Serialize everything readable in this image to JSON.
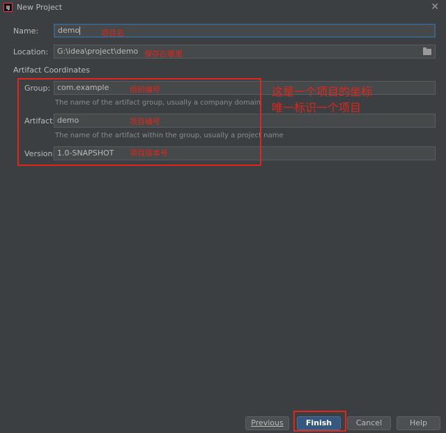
{
  "window": {
    "title": "New Project",
    "app_icon_text": "IJ"
  },
  "form": {
    "name_label": "Name:",
    "name_value": "demo",
    "location_label": "Location:",
    "location_value": "G:\\idea\\project\\demo",
    "section_title": "Artifact Coordinates",
    "group_label": "Group:",
    "group_value": "com.example",
    "group_hint": "The name of the artifact group, usually a company domain",
    "artifact_label": "Artifact:",
    "artifact_value": "demo",
    "artifact_hint": "The name of the artifact within the group, usually a project name",
    "version_label": "Version:",
    "version_value": "1.0-SNAPSHOT"
  },
  "annotations": {
    "name_note": "项目名",
    "location_note": "保存在哪里",
    "group_note": "组织编号",
    "artifact_note": "项目编号",
    "version_note": "项目版本号",
    "coord_line1": "这是一个项目的坐标",
    "coord_line2": "唯一标识一个项目"
  },
  "buttons": {
    "previous": "Previous",
    "finish": "Finish",
    "cancel": "Cancel",
    "help": "Help"
  },
  "colors": {
    "background": "#3c3f41",
    "annotation_red": "#e0261d",
    "primary_button": "#365880",
    "focus_border": "#3d6185"
  }
}
